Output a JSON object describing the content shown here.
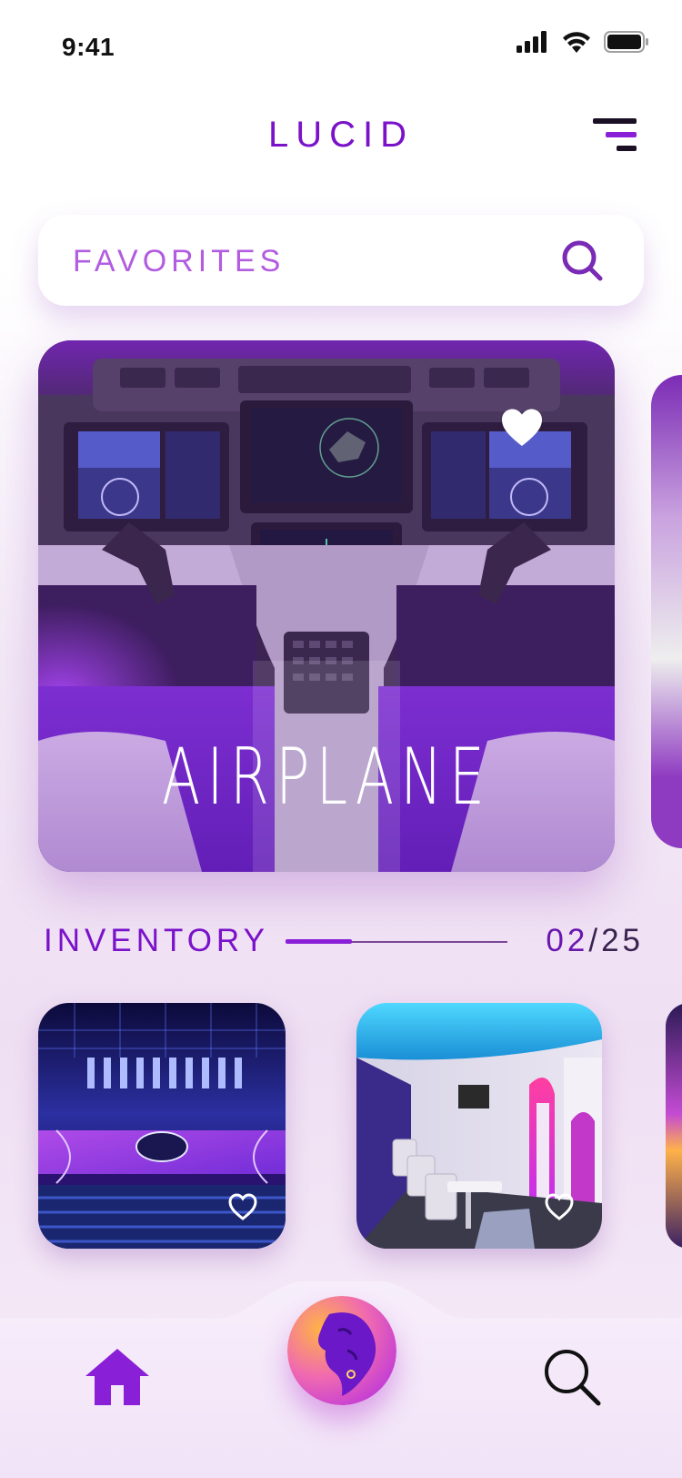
{
  "status_bar": {
    "time": "9:41"
  },
  "header": {
    "brand": "LUCID"
  },
  "search": {
    "placeholder": "FAVORITES"
  },
  "hero": {
    "title": "AIRPLANE",
    "favorited": true
  },
  "inventory": {
    "label": "INVENTORY",
    "current": "02",
    "separator": "/",
    "total": "25",
    "progress": 0.3
  },
  "inventory_items": [
    {
      "image": "arena-court",
      "favorited": false
    },
    {
      "image": "lounge-interior",
      "favorited": false
    }
  ],
  "bottom_nav": {
    "items": [
      "home-icon",
      "profile-avatar",
      "search-icon"
    ]
  },
  "colors": {
    "accent": "#7a12c9",
    "accent_light": "#b25ce0",
    "background": "#f3e9f6"
  }
}
